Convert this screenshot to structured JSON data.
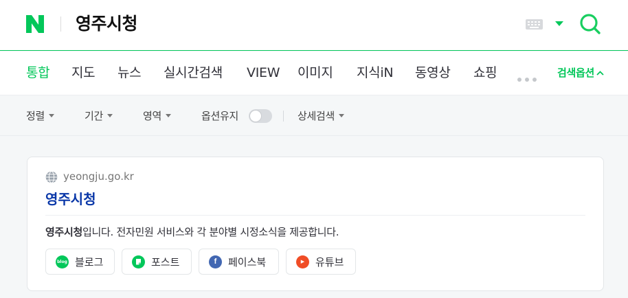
{
  "colors": {
    "brand": "#03c75a",
    "link_title": "#0937a8",
    "facebook": "#4267b2",
    "youtube": "#f04d26"
  },
  "header": {
    "logo": "N",
    "query": "영주시청"
  },
  "tabs": [
    {
      "label": "통합",
      "active": true
    },
    {
      "label": "지도"
    },
    {
      "label": "뉴스"
    },
    {
      "label": "실시간검색"
    },
    {
      "label": "VIEW"
    },
    {
      "label": "이미지"
    },
    {
      "label": "지식iN"
    },
    {
      "label": "동영상"
    },
    {
      "label": "쇼핑"
    }
  ],
  "search_options_label": "검색옵션",
  "options": {
    "sort": "정렬",
    "period": "기간",
    "area": "영역",
    "keep": "옵션유지",
    "detail": "상세검색",
    "keep_enabled": false
  },
  "result": {
    "url": "yeongju.go.kr",
    "title": "영주시청",
    "desc_bold": "영주시청",
    "desc_rest": "입니다. 전자민원 서비스와 각 분야별 시정소식을 제공합니다.",
    "links": [
      {
        "label": "블로그",
        "icon_text": "blog",
        "icon": "blog-icon"
      },
      {
        "label": "포스트",
        "icon_text": "",
        "icon": "post-icon"
      },
      {
        "label": "페이스북",
        "icon_text": "f",
        "icon": "facebook-icon"
      },
      {
        "label": "유튜브",
        "icon_text": "▶",
        "icon": "youtube-icon"
      }
    ]
  }
}
